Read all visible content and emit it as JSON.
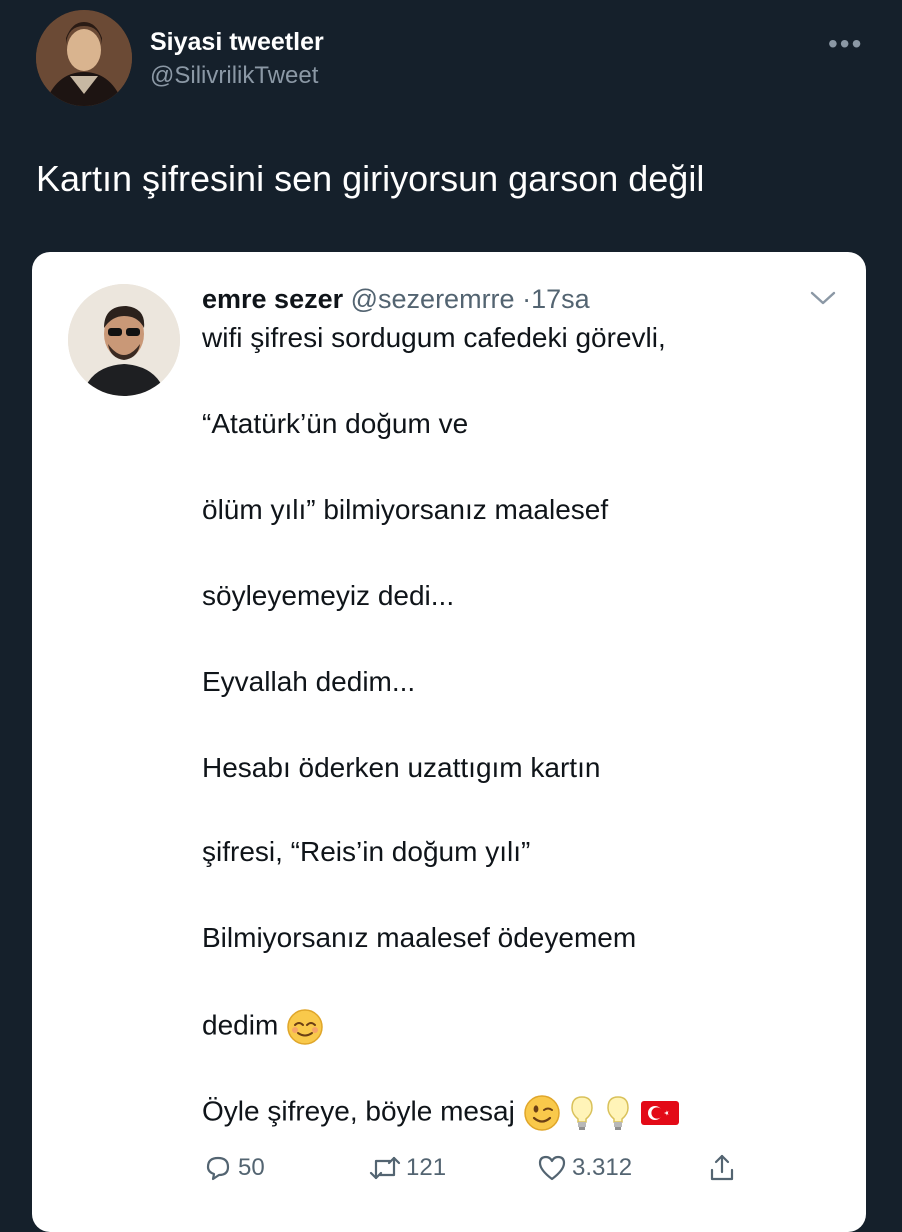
{
  "tweet": {
    "author_name": "Siyasi tweetler",
    "author_handle": "@SilivrilikTweet",
    "more_label": "•••",
    "text": "Kartın şifresini sen giriyorsun garson değil"
  },
  "quoted": {
    "name": "emre sezer",
    "handle": "@sezeremrre",
    "separator": "·",
    "time": "17sa",
    "lines": [
      "wifi şifresi sordugum cafedeki görevli,",
      "“Atatürk’ün doğum ve",
      "ölüm yılı” bilmiyorsanız maalesef",
      "söyleyemeyiz dedi...",
      "Eyvallah dedim...",
      "Hesabı öderken uzattıgım kartın",
      "şifresi, “Reis’in doğum yılı”",
      "Bilmiyorsanız maalesef ödeyemem",
      "dedim",
      "Öyle şifreye, böyle mesaj"
    ],
    "line9_emoji": "relieved-face-icon",
    "line10_emojis": [
      "winking-face-icon",
      "light-bulb-icon",
      "light-bulb-icon",
      "turkey-flag-icon"
    ]
  },
  "actions": {
    "replies": "50",
    "retweets": "121",
    "likes": "3.312"
  }
}
